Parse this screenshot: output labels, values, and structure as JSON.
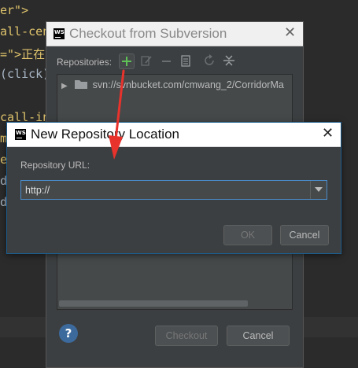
{
  "editor": {
    "lines": [
      "er\">",
      "all-cen",
      "=\">正在",
      "(click)",
      "call-in",
      "m",
      "e",
      "d",
      "d"
    ]
  },
  "checkout_dialog": {
    "title": "Checkout from Subversion",
    "repositories_label": "Repositories:",
    "repo_entry": "svn://svnbucket.com/cmwang_2/CorridorMa",
    "checkout_label": "Checkout",
    "cancel_label": "Cancel",
    "help_label": "?"
  },
  "new_repo_dialog": {
    "title": "New Repository Location",
    "url_label": "Repository URL:",
    "url_value": "http://",
    "ok_label": "OK",
    "cancel_label": "Cancel"
  },
  "app_badge": "WS",
  "colors": {
    "accent_red": "#e8322c",
    "add_green": "#5ec256",
    "focus_blue": "#4b8ccb"
  }
}
